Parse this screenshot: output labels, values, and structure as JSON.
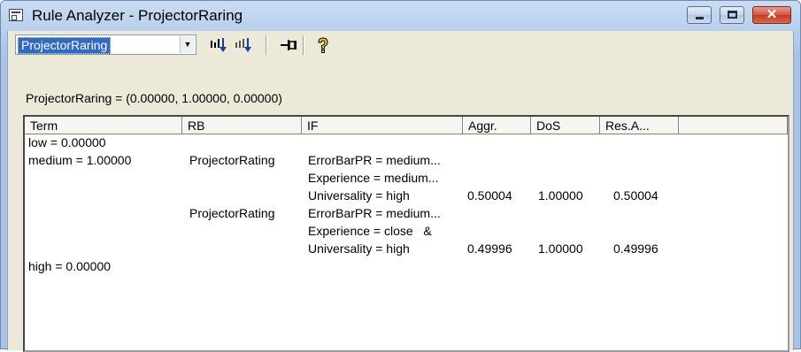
{
  "window": {
    "title": "Rule Analyzer - ProjectorRaring",
    "controls": {
      "close_label": "✕"
    }
  },
  "toolbar": {
    "variable_select": {
      "selected": "ProjectorRaring"
    },
    "combo_arrow": "▼",
    "icons": [
      "bars-down-icon",
      "bars-down-alt-icon",
      "pin-icon",
      "help-icon"
    ]
  },
  "formula": "ProjectorRaring = (0.00000, 1.00000, 0.00000)",
  "table": {
    "columns": [
      "Term",
      "RB",
      "IF",
      "Aggr.",
      "DoS",
      "Res.A..."
    ],
    "terms": [
      "low = 0.00000",
      "medium = 1.00000",
      "high = 0.00000"
    ],
    "rules": [
      {
        "rb": "ProjectorRating",
        "if_lines": [
          "ErrorBarPR = medium...",
          "Experience = medium...",
          "Universality = high"
        ],
        "aggr": "0.50004",
        "dos": "1.00000",
        "res": "0.50004"
      },
      {
        "rb": "ProjectorRating",
        "if_lines": [
          "ErrorBarPR = medium...",
          "Experience = close   &",
          "Universality = high"
        ],
        "aggr": "0.49996",
        "dos": "1.00000",
        "res": "0.49996"
      }
    ]
  },
  "colors": {
    "selection": "#316ac5",
    "close_button": "#c23a22",
    "frame": "#b6cdea"
  }
}
